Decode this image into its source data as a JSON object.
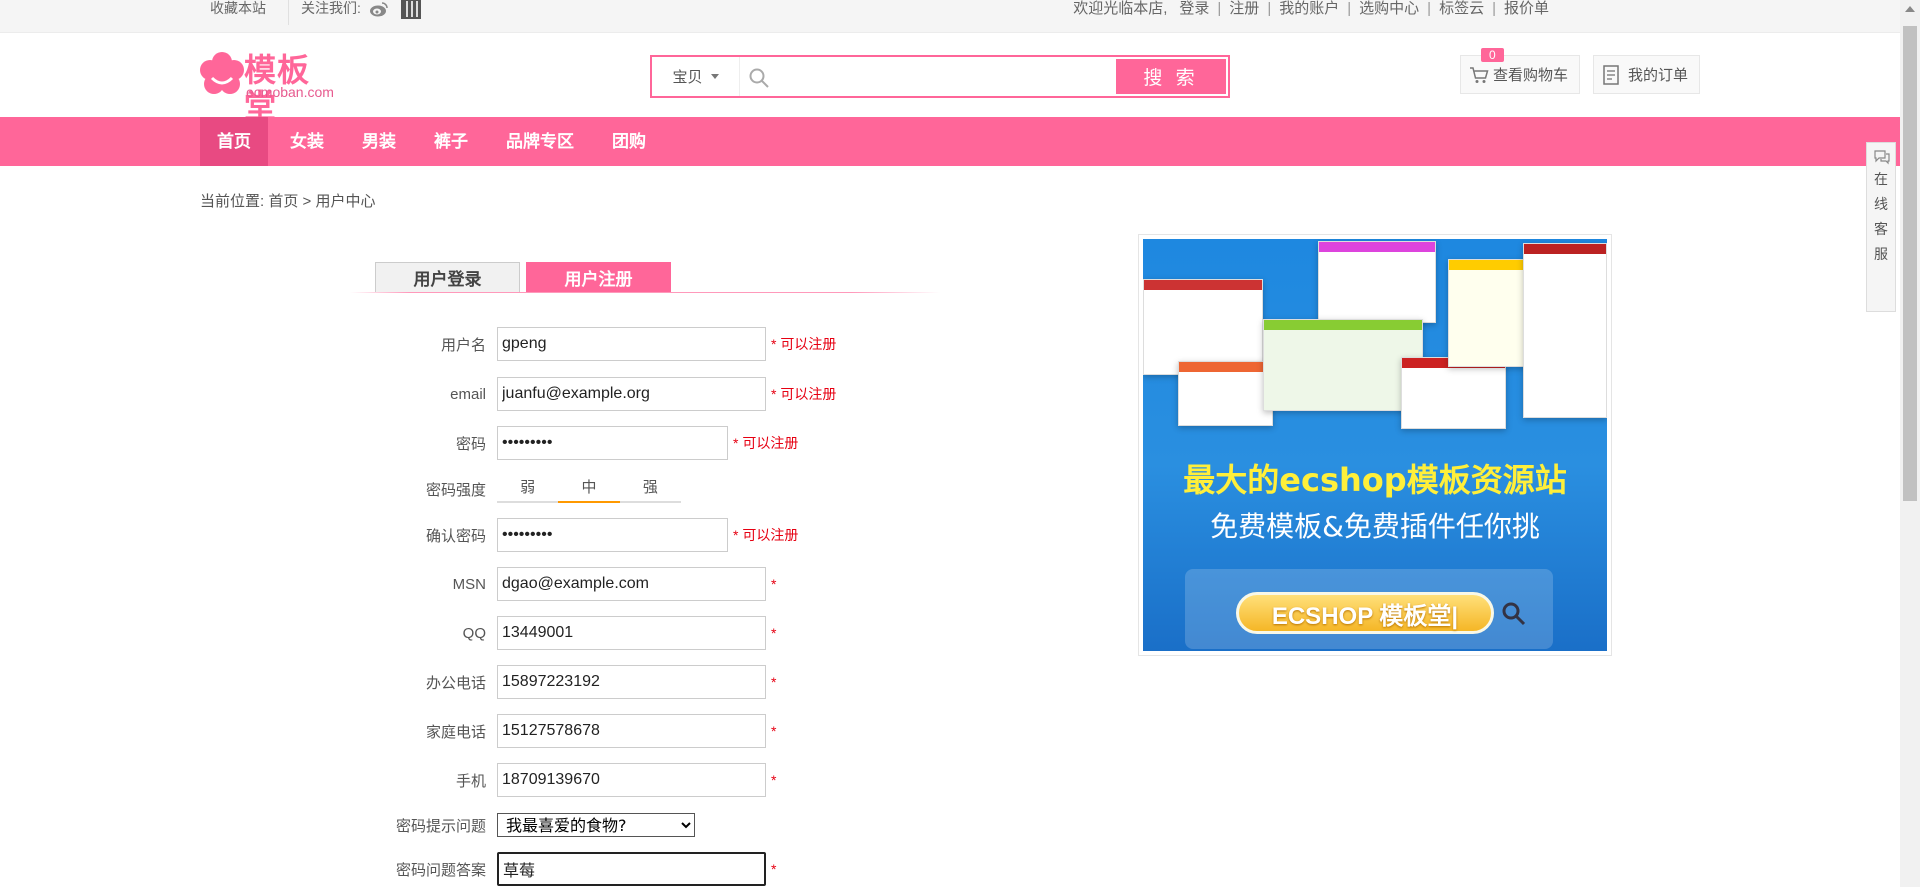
{
  "topbar": {
    "favorite": "收藏本站",
    "follow": "关注我们:",
    "welcome": "欢迎光临本店,",
    "links": [
      "登录",
      "注册",
      "我的账户",
      "选购中心",
      "标签云",
      "报价单"
    ]
  },
  "logo": {
    "brand": "模板堂",
    "domain": "ecmoban.com"
  },
  "search": {
    "scope": "宝贝",
    "placeholder": "",
    "button": "搜 索"
  },
  "cart": {
    "label": "查看购物车",
    "count": "0"
  },
  "orders": {
    "label": "我的订单"
  },
  "nav": [
    "首页",
    "女装",
    "男装",
    "裤子",
    "品牌专区",
    "团购"
  ],
  "breadcrumb": {
    "prefix": "当前位置: ",
    "home": "首页",
    "sep": " > ",
    "current": "用户中心"
  },
  "tabs": {
    "login": "用户登录",
    "register": "用户注册"
  },
  "form": {
    "username": {
      "label": "用户名",
      "value": "gpeng",
      "note": "* 可以注册"
    },
    "email": {
      "label": "email",
      "value": "juanfu@example.org",
      "note": "* 可以注册"
    },
    "password": {
      "label": "密码",
      "value": "123456789",
      "note": "* 可以注册"
    },
    "strength": {
      "label": "密码强度",
      "levels": [
        "弱",
        "中",
        "强"
      ],
      "active": "中"
    },
    "confirm": {
      "label": "确认密码",
      "value": "123456789",
      "note": "* 可以注册"
    },
    "msn": {
      "label": "MSN",
      "value": "dgao@example.com",
      "note": "*"
    },
    "qq": {
      "label": "QQ",
      "value": "13449001",
      "note": "*"
    },
    "office_phone": {
      "label": "办公电话",
      "value": "15897223192",
      "note": "*"
    },
    "home_phone": {
      "label": "家庭电话",
      "value": "15127578678",
      "note": "*"
    },
    "mobile": {
      "label": "手机",
      "value": "18709139670",
      "note": "*"
    },
    "question": {
      "label": "密码提示问题",
      "value": "我最喜爱的食物?"
    },
    "answer": {
      "label": "密码问题答案",
      "value": "草莓",
      "note": "*"
    }
  },
  "banner": {
    "title": "最大的ecshop模板资源站",
    "subtitle": "免费模板&免费插件任你挑",
    "pill": "ECSHOP 模板堂|"
  },
  "service": [
    "在",
    "线",
    "客",
    "服"
  ],
  "colors": {
    "brand": "#ff6699",
    "nav_active": "#e84a82",
    "required": "#e60012"
  }
}
